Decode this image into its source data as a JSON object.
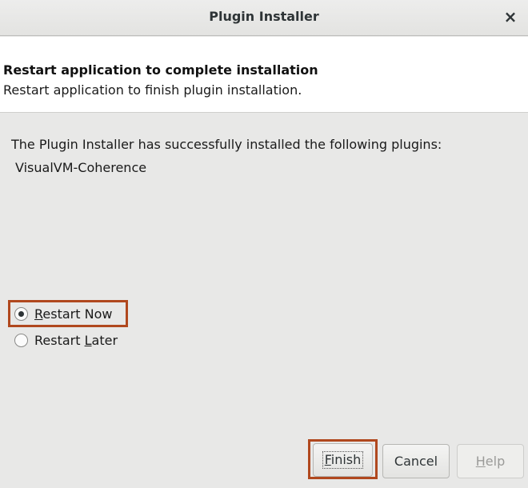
{
  "window": {
    "title": "Plugin Installer",
    "close_glyph": "×",
    "close_icon": "close-icon"
  },
  "header": {
    "title": "Restart application to complete installation",
    "subtitle": "Restart application to finish plugin installation."
  },
  "body": {
    "message": "The Plugin Installer has successfully installed the following plugins:",
    "plugins": [
      "VisualVM-Coherence"
    ]
  },
  "options": {
    "restart_now": {
      "mnemonic": "R",
      "rest": "estart Now",
      "selected": true
    },
    "restart_later": {
      "prefix": "Restart ",
      "mnemonic": "L",
      "rest": "ater",
      "selected": false
    }
  },
  "buttons": {
    "finish": {
      "mnemonic": "F",
      "rest": "inish"
    },
    "cancel": {
      "label": "Cancel"
    },
    "help": {
      "mnemonic": "H",
      "rest": "elp",
      "enabled": false
    }
  },
  "colors": {
    "highlight": "#b0481e",
    "background": "#e8e8e7"
  }
}
